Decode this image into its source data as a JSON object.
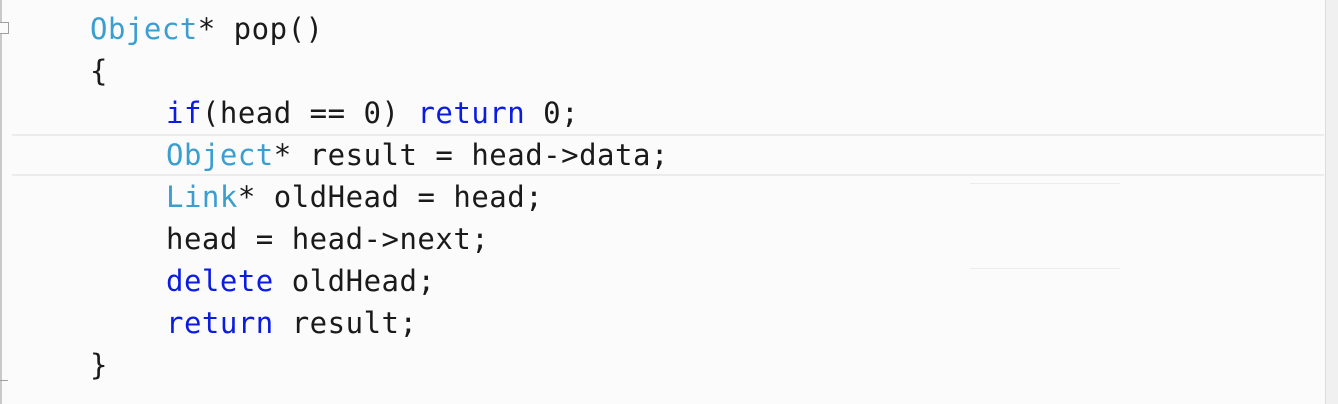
{
  "editor": {
    "colors": {
      "background": "#fbfbfb",
      "keyword": "#0b1ce0",
      "type": "#3a9fd0",
      "text": "#1a1a1a"
    },
    "lines": [
      [
        {
          "text": "Object",
          "kind": "type"
        },
        {
          "text": "* pop()",
          "kind": "plain"
        }
      ],
      [
        {
          "text": "{",
          "kind": "plain"
        }
      ],
      [
        {
          "text": "if",
          "kind": "kw"
        },
        {
          "text": "(head == 0) ",
          "kind": "plain"
        },
        {
          "text": "return",
          "kind": "kw"
        },
        {
          "text": " 0;",
          "kind": "plain"
        }
      ],
      [
        {
          "text": "Object",
          "kind": "type"
        },
        {
          "text": "* result = head->data;",
          "kind": "plain"
        }
      ],
      [
        {
          "text": "Link",
          "kind": "type"
        },
        {
          "text": "* oldHead = head;",
          "kind": "plain"
        }
      ],
      [
        {
          "text": "head = head->next;",
          "kind": "plain"
        }
      ],
      [
        {
          "text": "delete",
          "kind": "kw"
        },
        {
          "text": " oldHead;",
          "kind": "plain"
        }
      ],
      [
        {
          "text": "return",
          "kind": "kw"
        },
        {
          "text": " result;",
          "kind": "plain"
        }
      ],
      [
        {
          "text": "}",
          "kind": "plain"
        }
      ]
    ]
  }
}
